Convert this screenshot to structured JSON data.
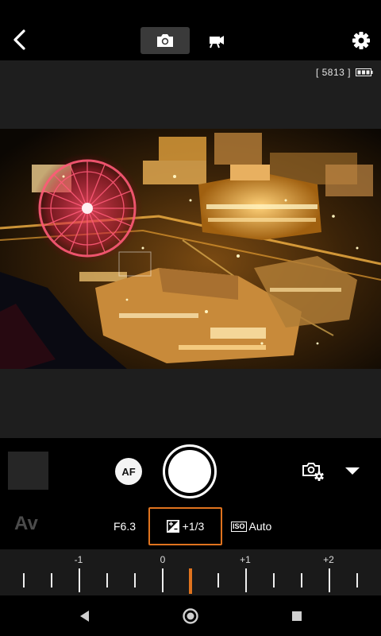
{
  "status": {
    "shot_count": "[ 5813 ]"
  },
  "controls": {
    "af_label": "AF",
    "mode_label": "Av",
    "aperture": "F6.3",
    "exposure_comp": "+1/3",
    "iso_badge": "ISO",
    "iso_value": "Auto"
  },
  "scale": {
    "labels": [
      "-1",
      "0",
      "+1",
      "+2"
    ],
    "selected_offset_thirds": 1
  },
  "colors": {
    "accent": "#e0731e",
    "background": "#000000",
    "liveview": "#1e1e1e"
  },
  "icons": {
    "back": "chevron-left-icon",
    "photo_mode": "camera-icon",
    "video_mode": "video-camera-icon",
    "settings": "gear-icon",
    "battery": "battery-icon",
    "camera_settings": "camera-settings-icon",
    "dropdown": "triangle-down-icon"
  }
}
